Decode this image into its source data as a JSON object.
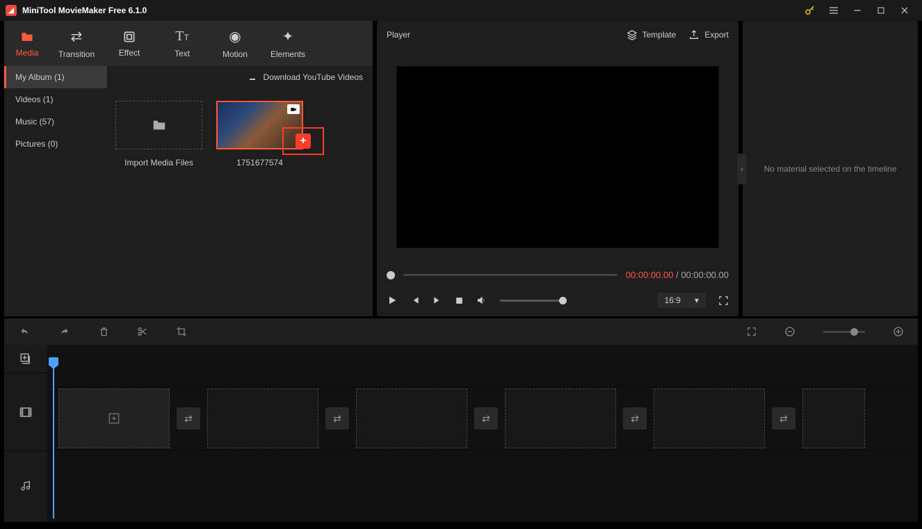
{
  "window": {
    "title": "MiniTool MovieMaker Free 6.1.0"
  },
  "tabs": [
    {
      "label": "Media",
      "active": true
    },
    {
      "label": "Transition"
    },
    {
      "label": "Effect"
    },
    {
      "label": "Text"
    },
    {
      "label": "Motion"
    },
    {
      "label": "Elements"
    }
  ],
  "albums": [
    {
      "label": "My Album (1)",
      "active": true
    },
    {
      "label": "Videos (1)"
    },
    {
      "label": "Music (57)"
    },
    {
      "label": "Pictures (0)"
    }
  ],
  "download_link": "Download YouTube Videos",
  "import_label": "Import Media Files",
  "clip": {
    "name": "1751677574"
  },
  "player": {
    "title": "Player",
    "template": "Template",
    "export": "Export",
    "current": "00:00:00.00",
    "sep": "/",
    "total": "00:00:00.00",
    "aspect": "16:9"
  },
  "sidepanel": {
    "msg": "No material selected on the timeline"
  }
}
